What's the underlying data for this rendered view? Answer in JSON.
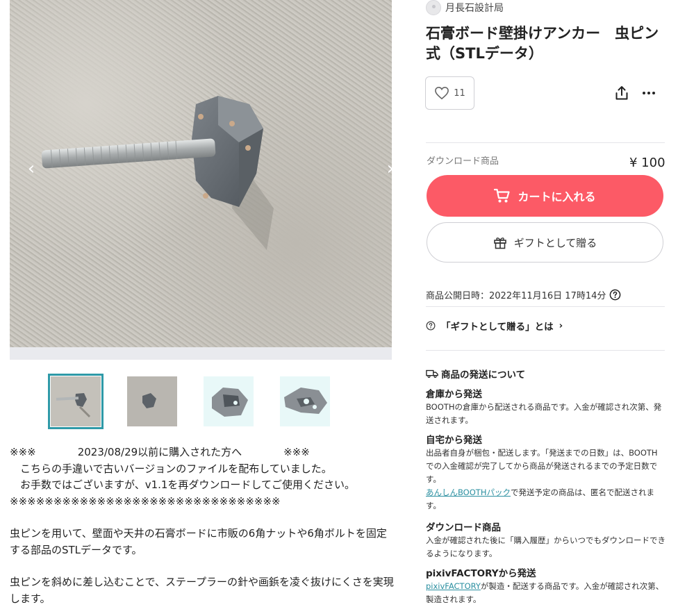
{
  "gallery": {
    "prev_glyph": "‹",
    "next_glyph": "›",
    "thumbnails": [
      {
        "name": "photo-anchor-with-bolt",
        "active": true
      },
      {
        "name": "photo-anchor-on-wall",
        "active": false
      },
      {
        "name": "render-front",
        "active": false
      },
      {
        "name": "render-side",
        "active": false
      }
    ]
  },
  "description": {
    "lines_notice": [
      "※※※　　　　2023/08/29以前に購入された方へ　　　　※※※",
      "　こちらの手違いで古いバージョンのファイルを配布していました。",
      "　お手数ではございますが、v1.1を再ダウンロードしてご使用ください。",
      "※※※※※※※※※※※※※※※※※※※※※※※※※※※※※※※"
    ],
    "para1": "虫ピンを用いて、壁面や天井の石膏ボードに市販の6角ナットや6角ボルトを固定する部品のSTLデータです。",
    "para2": "虫ピンを斜めに差し込むことで、ステープラーの針や画鋲を凌ぐ抜けにくさを実現します。"
  },
  "shop": {
    "name": "月長石設計局"
  },
  "product": {
    "title": "石膏ボード壁掛けアンカー　虫ピン式（STLデータ）",
    "like_count": "11",
    "type_label": "ダウンロード商品",
    "price": "¥ 100",
    "cart_label": "カートに入れる",
    "gift_label": "ギフトとして贈る",
    "published": "商品公開日時：2022年11月16日 17時14分",
    "gift_info": "「ギフトとして贈る」とは",
    "gift_info_chevron": "›"
  },
  "shipping": {
    "heading": "商品の発送について",
    "warehouse": {
      "title": "倉庫から発送",
      "body": "BOOTHの倉庫から配送される商品です。入金が確認され次第、発送されます。"
    },
    "self": {
      "title": "自宅から発送",
      "body": "出品者自身が梱包・配送します。「発送までの日数」は、BOOTHでの入金確認が完了してから商品が発送されるまでの予定日数です。",
      "link": "あんしんBOOTHパック",
      "body2": "で発送予定の商品は、匿名で配送されます。"
    },
    "download": {
      "title": "ダウンロード商品",
      "body": "入金が確認された後に「購入履歴」からいつでもダウンロードできるようになります。"
    },
    "factory": {
      "title": "pixivFACTORYから発送",
      "link": "pixivFACTORY",
      "body": "が製造・配送する商品です。入金が確認され次第、製造されます。"
    }
  },
  "colors": {
    "accent": "#fc5a66",
    "link": "#2a8fa0",
    "thumb_active": "#2f9aa8"
  }
}
